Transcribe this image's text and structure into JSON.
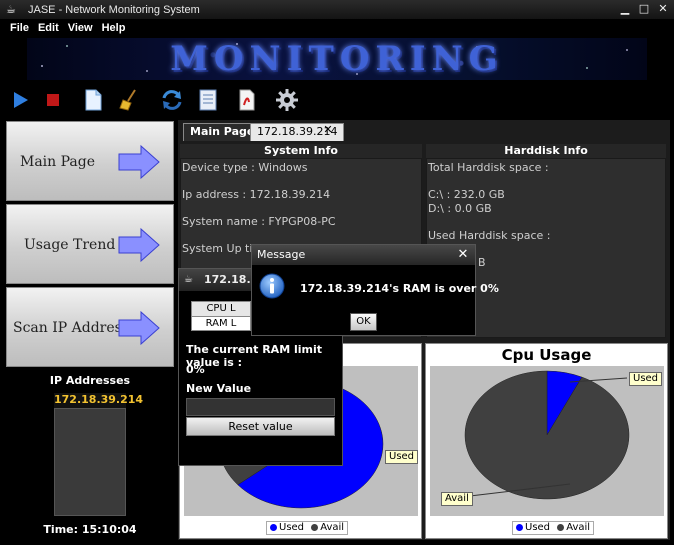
{
  "window": {
    "title": "JASE - Network Monitoring System",
    "app_icon": "coffee-cup-icon",
    "controls": {
      "minimize": "▁",
      "maximize": "□",
      "close": "✕"
    }
  },
  "menu": [
    "File",
    "Edit",
    "View",
    "Help"
  ],
  "banner": {
    "text": "MONITORING"
  },
  "toolbar": [
    {
      "name": "play-icon"
    },
    {
      "name": "stop-icon"
    },
    {
      "name": "new-document-icon"
    },
    {
      "name": "broom-icon"
    },
    {
      "name": "refresh-icon"
    },
    {
      "name": "list-document-icon"
    },
    {
      "name": "pdf-report-icon"
    },
    {
      "name": "settings-gear-icon"
    }
  ],
  "sidebar": {
    "buttons": [
      "Main Page",
      "Usage Trend",
      "Scan IP Address"
    ],
    "ip_panel": {
      "title": "IP Addresses",
      "selected_ip": "172.18.39.214",
      "time_label": "Time: 15:10:04"
    }
  },
  "tabs": {
    "main": "Main Page",
    "ip": "172.18.39.214"
  },
  "system_info": {
    "header": "System Info",
    "device_type": "Device type : Windows",
    "ip_address": "Ip address : 172.18.39.214",
    "system_name": "System name : FYPGP08-PC",
    "system_up_time": "System Up tim"
  },
  "harddisk_info": {
    "header": "Harddisk Info",
    "total_space_label": "Total Harddisk space :",
    "drive_c": "C:\\ : 232.0 GB",
    "drive_d": "D:\\ : 0.0 GB",
    "used_space_label": "Used Harddisk space :",
    "used_value_fragment": "B"
  },
  "ram_window": {
    "title": "172.18.39.",
    "tab_cpu": "CPU L",
    "tab_ram": "RAM L",
    "limit_text": "The current RAM limit value is :",
    "limit_value": "0%",
    "new_value_label": "New Value",
    "new_value_input": "",
    "reset_button": "Reset value"
  },
  "message_dialog": {
    "title": "Message",
    "close": "✕",
    "icon": "info-icon",
    "text": "172.18.39.214's RAM is over 0%",
    "ok_button": "OK"
  },
  "chart_data": [
    {
      "type": "pie",
      "title": "",
      "labels": [
        "Used",
        "Avail"
      ],
      "values": [
        64,
        36
      ],
      "colors": [
        "#0000ff",
        "#404040"
      ],
      "legend": [
        "Used",
        "Avail"
      ],
      "legend_position": "bottom"
    },
    {
      "type": "pie",
      "title": "Cpu Usage",
      "labels": [
        "Used",
        "Avail"
      ],
      "values": [
        7,
        93
      ],
      "colors": [
        "#0000ff",
        "#404040"
      ],
      "legend": [
        "Used",
        "Avail"
      ],
      "legend_position": "bottom"
    }
  ],
  "colors": {
    "accent_ip": "#f2c230",
    "used": "#0000ff",
    "avail": "#404040"
  }
}
